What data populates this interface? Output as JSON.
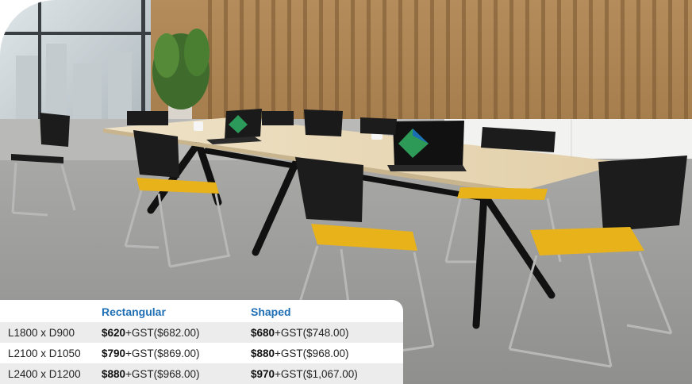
{
  "pricing": {
    "headers": [
      "",
      "Rectangular",
      "Shaped"
    ],
    "rows": [
      {
        "size": "L1800 x D900",
        "rect_price": "$620",
        "rect_suffix": "+GST($682.00)",
        "shaped_price": "$680",
        "shaped_suffix": "+GST($748.00)"
      },
      {
        "size": "L2100 x D1050",
        "rect_price": "$790",
        "rect_suffix": "+GST($869.00)",
        "shaped_price": "$880",
        "shaped_suffix": "+GST($968.00)"
      },
      {
        "size": "L2400 x D1200",
        "rect_price": "$880",
        "rect_suffix": "+GST($968.00)",
        "shaped_price": "$970",
        "shaped_suffix": "+GST($1,067.00)"
      }
    ]
  },
  "colors": {
    "header_blue": "#1f6fb5",
    "chair_seat_yellow": "#e8b21b",
    "table_top": "#e7d7b8",
    "table_frame": "#111111"
  }
}
